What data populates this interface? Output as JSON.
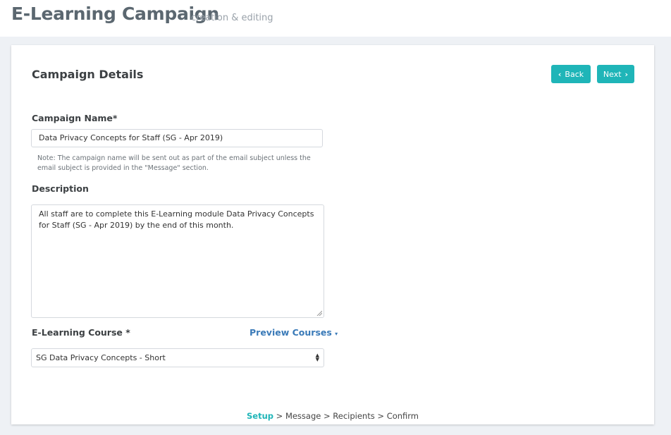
{
  "header": {
    "title": "E-Learning Campaign",
    "subtitle": "creation & editing"
  },
  "card": {
    "title": "Campaign Details",
    "back_label": "Back",
    "next_label": "Next"
  },
  "form": {
    "campaign_name_label": "Campaign Name*",
    "campaign_name_value": "Data Privacy Concepts for Staff (SG - Apr 2019)",
    "campaign_name_note": "Note: The campaign name will be sent out as part of the email subject unless the email subject is provided in the \"Message\" section.",
    "description_label": "Description",
    "description_value": "All staff are to complete this E-Learning module Data Privacy Concepts for Staff (SG - Apr 2019) by the end of this month.",
    "course_label": "E-Learning Course *",
    "preview_link": "Preview Courses",
    "course_selected": "SG Data Privacy Concepts - Short"
  },
  "steps": {
    "current": "Setup",
    "separator": ">",
    "rest": [
      "Message",
      "Recipients",
      "Confirm"
    ]
  },
  "colors": {
    "accent": "#1fb5b8",
    "link": "#3a7ab8",
    "background": "#eef1f5"
  }
}
